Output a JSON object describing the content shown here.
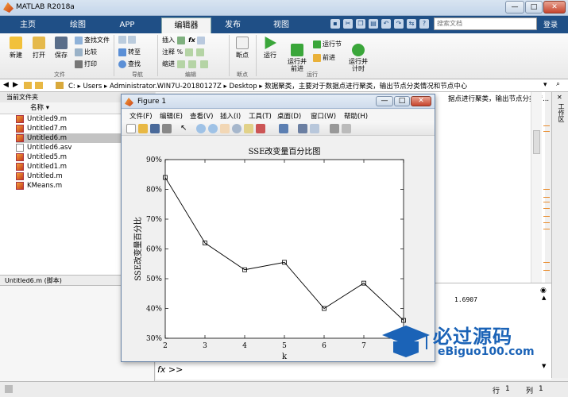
{
  "app": {
    "title": "MATLAB R2018a"
  },
  "window_buttons": {
    "minimize": "—",
    "maximize": "□",
    "close": "✕"
  },
  "tabs": [
    {
      "label": "主页"
    },
    {
      "label": "绘图"
    },
    {
      "label": "APP"
    },
    {
      "label": "编辑器"
    },
    {
      "label": "发布"
    },
    {
      "label": "视图"
    }
  ],
  "search": {
    "placeholder": "搜索文档"
  },
  "login": "登录",
  "ribbon": {
    "new": "新建",
    "open": "打开",
    "save": "保存",
    "find_files": "查找文件",
    "compare": "比较",
    "print": "打印",
    "goto": "转至",
    "find": "查找",
    "insert": "插入",
    "comment": "注释",
    "indent": "缩进",
    "breakpoints": "断点",
    "run": "运行",
    "run_advance": "运行并\n前进",
    "run_section": "运行节",
    "advance": "前进",
    "run_time": "运行并\n计时",
    "groups": {
      "file": "文件",
      "navigate": "导航",
      "edit": "编辑",
      "breakpoint": "断点",
      "run": "运行"
    }
  },
  "address": {
    "path": "C:  ▸  Users  ▸  Administrator.WIN7U-20180127Z  ▸  Desktop  ▸  数据聚类，主要对于数据点进行聚类，输出节点分类情况和节点中心"
  },
  "current_folder": {
    "header": "当前文件夹",
    "column": "名称 ▾",
    "files": [
      {
        "name": "Untitled9.m",
        "type": "m"
      },
      {
        "name": "Untitled7.m",
        "type": "m"
      },
      {
        "name": "Untitled6.m",
        "type": "m",
        "selected": true
      },
      {
        "name": "Untitled6.asv",
        "type": "asv"
      },
      {
        "name": "Untitled5.m",
        "type": "m"
      },
      {
        "name": "Untitled1.m",
        "type": "m"
      },
      {
        "name": "Untitled.m",
        "type": "m"
      },
      {
        "name": "KMeans.m",
        "type": "m"
      }
    ],
    "details": "Untitled6.m  (脚本)"
  },
  "editor_tab_text": "据点进行聚类，输出节点分类情...",
  "workspace_label": "工作区",
  "command": {
    "value_label": "2",
    "value": "1.6907",
    "prompt": "fx >>"
  },
  "status": {
    "row_label": "行",
    "row": "1",
    "col_label": "列",
    "col": "1"
  },
  "figure": {
    "title": "Figure 1",
    "menu": [
      "文件(F)",
      "编辑(E)",
      "查看(V)",
      "插入(I)",
      "工具(T)",
      "桌面(D)",
      "窗口(W)",
      "帮助(H)"
    ]
  },
  "chart_data": {
    "type": "line",
    "title": "SSE改变量百分比图",
    "xlabel": "k",
    "ylabel": "SSE改变量百分比",
    "x": [
      2,
      3,
      4,
      5,
      6,
      7,
      8
    ],
    "series": [
      {
        "values": [
          0.84,
          0.62,
          0.53,
          0.555,
          0.4,
          0.485,
          0.36
        ],
        "marker": "s"
      }
    ],
    "xlim": [
      2,
      8
    ],
    "ylim": [
      0.3,
      0.9
    ],
    "xticks": [
      "2",
      "3",
      "4",
      "5",
      "6",
      "7",
      "8"
    ],
    "yticks": [
      "30%",
      "40%",
      "50%",
      "60%",
      "70%",
      "80%",
      "90%"
    ],
    "grid": false,
    "line_color": "#000000"
  },
  "watermark": {
    "big": "必过源码",
    "small": "eBiguo100.com"
  }
}
